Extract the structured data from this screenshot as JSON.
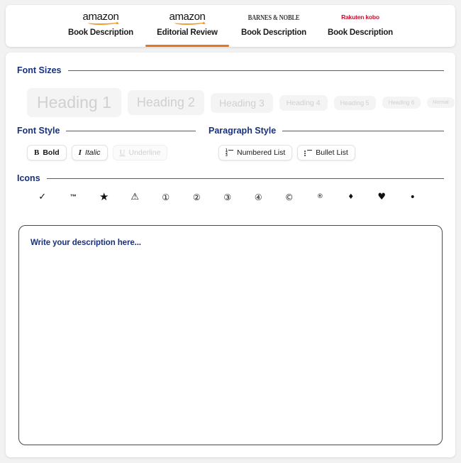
{
  "tabs": [
    {
      "brand": "amazon",
      "brand_kind": "amazon",
      "label": "Book Description",
      "active": false
    },
    {
      "brand": "amazon",
      "brand_kind": "amazon",
      "label": "Editorial Review",
      "active": true
    },
    {
      "brand": "BARNES & NOBLE",
      "brand_kind": "bn",
      "label": "Book Description",
      "active": false
    },
    {
      "brand": "Rakuten kobo",
      "brand_kind": "kobo",
      "label": "Book Description",
      "active": false
    }
  ],
  "sections": {
    "font_sizes": "Font Sizes",
    "font_style": "Font Style",
    "paragraph_style": "Paragraph Style",
    "icons": "Icons"
  },
  "font_sizes": [
    {
      "label": "Heading 1",
      "class": "h1"
    },
    {
      "label": "Heading 2",
      "class": "h2"
    },
    {
      "label": "Heading 3",
      "class": "h3"
    },
    {
      "label": "Heading 4",
      "class": "h4"
    },
    {
      "label": "Heading 5",
      "class": "h5"
    },
    {
      "label": "Heading 6",
      "class": "h6"
    },
    {
      "label": "Normal",
      "class": "nm"
    }
  ],
  "font_style_buttons": [
    {
      "label": "Bold",
      "glyph": "B",
      "icon_name": "bold-icon",
      "disabled": false
    },
    {
      "label": "Italic",
      "glyph": "I",
      "icon_name": "italic-icon",
      "disabled": false
    },
    {
      "label": "Underline",
      "glyph": "U",
      "icon_name": "underline-icon",
      "disabled": true
    }
  ],
  "paragraph_style_buttons": [
    {
      "label": "Numbered List",
      "icon_name": "numbered-list-icon"
    },
    {
      "label": "Bullet List",
      "icon_name": "bullet-list-icon"
    }
  ],
  "icons": [
    {
      "glyph": "✓",
      "name": "checkmark-icon",
      "class": "chk"
    },
    {
      "glyph": "™",
      "name": "trademark-icon",
      "class": "tm"
    },
    {
      "glyph": "★",
      "name": "star-icon",
      "class": "star"
    },
    {
      "glyph": "⚠",
      "name": "warning-triangle-icon",
      "class": "warn"
    },
    {
      "glyph": "①",
      "name": "circled-one-icon",
      "class": "num"
    },
    {
      "glyph": "②",
      "name": "circled-two-icon",
      "class": "num"
    },
    {
      "glyph": "③",
      "name": "circled-three-icon",
      "class": "num"
    },
    {
      "glyph": "④",
      "name": "circled-four-icon",
      "class": "num"
    },
    {
      "glyph": "©",
      "name": "copyright-icon",
      "class": "cr"
    },
    {
      "glyph": "®",
      "name": "registered-icon",
      "class": "reg"
    },
    {
      "glyph": "♦",
      "name": "diamond-icon",
      "class": "dia"
    },
    {
      "glyph": "♥",
      "name": "heart-icon",
      "class": "heart"
    },
    {
      "glyph": "•",
      "name": "bullet-dot-icon",
      "class": "dot"
    }
  ],
  "editor": {
    "placeholder": "Write your description here...",
    "value": ""
  },
  "colors": {
    "accent_orange": "#e8751a",
    "heading_navy": "#17317f",
    "amazon_smile": "#f59a23",
    "kobo_red": "#c8102e",
    "chip_bg": "#f4f4f5",
    "chip_text": "#cfd0d3"
  }
}
